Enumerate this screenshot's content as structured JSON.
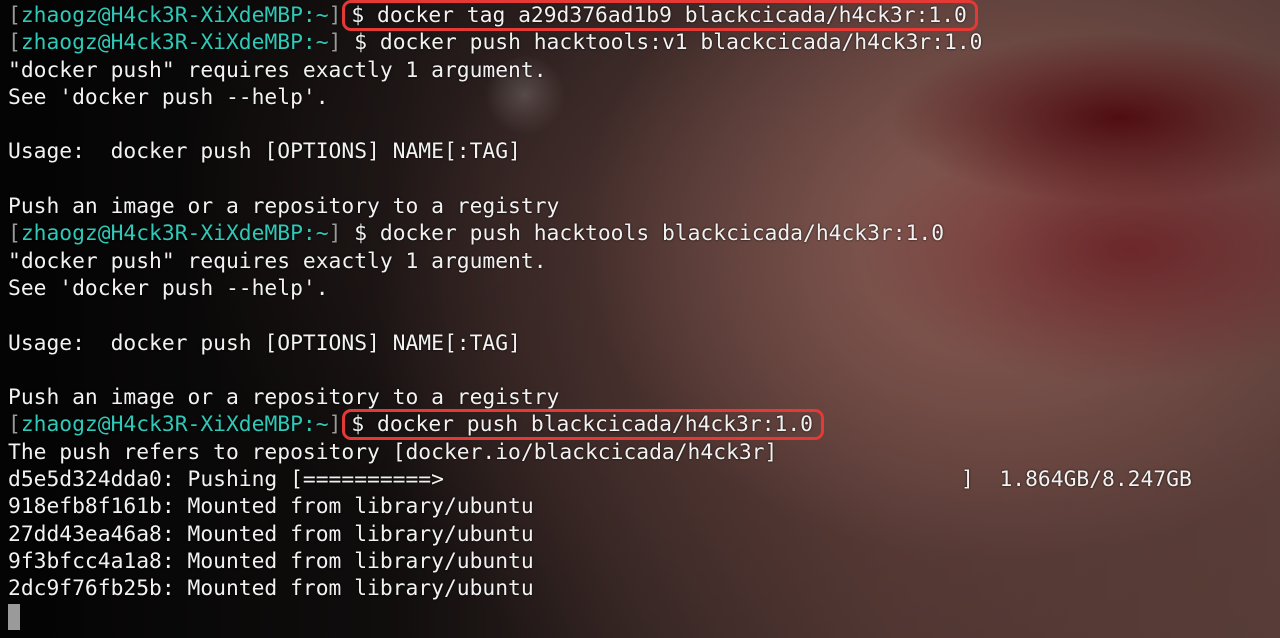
{
  "prompt": {
    "open": "[",
    "user": "zhaogz@H4ck3R-XiXdeMBP",
    "sep": ":~",
    "close": "]"
  },
  "commands": [
    "$ docker tag a29d376ad1b9 blackcicada/h4ck3r:1.0",
    "$ docker push hacktools:v1 blackcicada/h4ck3r:1.0",
    "$ docker push hacktools blackcicada/h4ck3r:1.0",
    "$ docker push blackcicada/h4ck3r:1.0"
  ],
  "errors": {
    "requires": "\"docker push\" requires exactly 1 argument.",
    "see_help": "See 'docker push --help'.",
    "usage": "Usage:  docker push [OPTIONS] NAME[:TAG]",
    "description": "Push an image or a repository to a registry"
  },
  "push_output": {
    "refers": "The push refers to repository [docker.io/blackcicada/h4ck3r]",
    "pushing_layer": "d5e5d324dda0: Pushing [==========>",
    "pushing_tail": "]  1.864GB/8.247GB",
    "progress_fraction": 0.226,
    "mounted": [
      "918efb8f161b: Mounted from library/ubuntu",
      "27dd43ea46a8: Mounted from library/ubuntu",
      "9f3bfcc4a1a8: Mounted from library/ubuntu",
      "2dc9f76fb25b: Mounted from library/ubuntu"
    ]
  },
  "colors": {
    "prompt_user": "#2fc9b8",
    "highlight_box": "#e53935",
    "text": "#f2f2f2"
  }
}
